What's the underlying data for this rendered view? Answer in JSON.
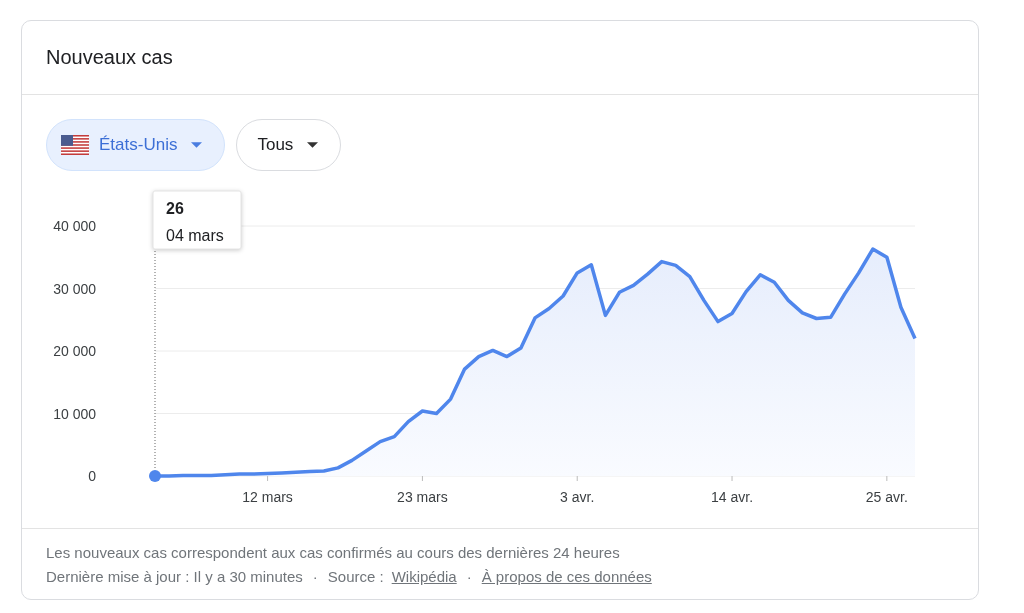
{
  "card": {
    "title": "Nouveaux cas"
  },
  "filters": [
    {
      "kind": "country",
      "label": "États-Unis",
      "selected": true
    },
    {
      "kind": "plain",
      "label": "Tous",
      "selected": false
    }
  ],
  "chart": {
    "tooltip": {
      "value": "26",
      "date": "04 mars"
    },
    "chart_data": {
      "type": "area",
      "grid": true,
      "ylim": [
        0,
        40000
      ],
      "categories": [
        null,
        null,
        null,
        null,
        null,
        null,
        null,
        null,
        "12 mars",
        null,
        null,
        null,
        null,
        null,
        null,
        null,
        null,
        null,
        null,
        "23 mars",
        null,
        null,
        null,
        null,
        null,
        null,
        null,
        null,
        null,
        null,
        "3 avr.",
        null,
        null,
        null,
        null,
        null,
        null,
        null,
        null,
        null,
        null,
        "14 avr.",
        null,
        null,
        null,
        null,
        null,
        null,
        null,
        null,
        null,
        null,
        "25 avr.",
        null,
        null
      ],
      "series": [
        {
          "color": "#4f86ec",
          "values": [
            0,
            0,
            100,
            100,
            100,
            200,
            300,
            300,
            400,
            500,
            600,
            700,
            800,
            1300,
            2500,
            4000,
            5500,
            6300,
            8700,
            10400,
            10000,
            12300,
            17100,
            19100,
            20100,
            19100,
            20500,
            25300,
            26800,
            28800,
            32500,
            33800,
            25700,
            29400,
            30500,
            32300,
            34300,
            33700,
            31900,
            28100,
            24700,
            26000,
            29500,
            32200,
            31000,
            28100,
            26100,
            25200,
            25400,
            29100,
            32500,
            36300,
            35000,
            27000,
            22000
          ]
        }
      ],
      "yticks": [
        {
          "value": 0,
          "label": "0"
        },
        {
          "value": 10000,
          "label": "10 000"
        },
        {
          "value": 20000,
          "label": "20 000"
        },
        {
          "value": 30000,
          "label": "30 000"
        },
        {
          "value": 40000,
          "label": "40 000"
        }
      ]
    }
  },
  "footer": {
    "note": "Les nouveaux cas correspondent aux cas confirmés au cours des dernières 24 heures",
    "updated": "Dernière mise à jour : Il y a 30 minutes",
    "separator_1": "·",
    "source_label": "Source :",
    "source_link": "Wikipédia",
    "separator_2": "·",
    "about_link": "À propos de ces données"
  }
}
